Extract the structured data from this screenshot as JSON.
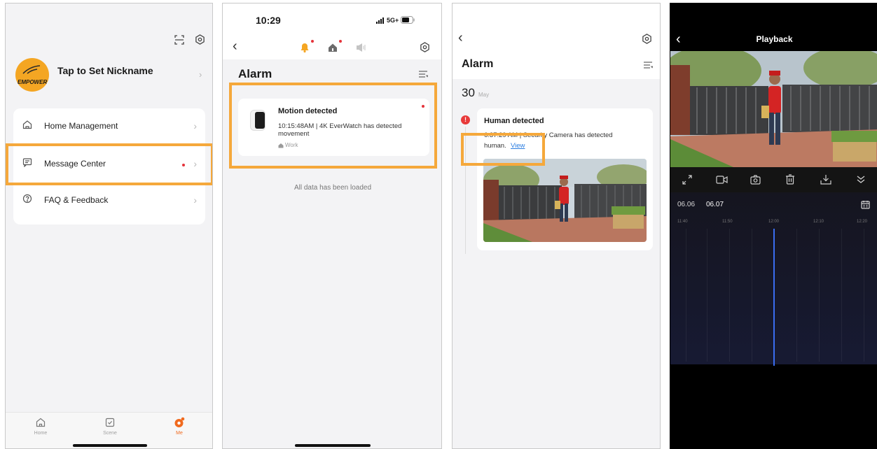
{
  "me_screen": {
    "avatar_text": "EMPOWER",
    "nickname": "Tap to Set Nickname",
    "menu": [
      {
        "label": "Home Management",
        "icon": "home-icon"
      },
      {
        "label": "Message Center",
        "icon": "message-icon"
      },
      {
        "label": "FAQ & Feedback",
        "icon": "help-icon"
      }
    ],
    "tabs": [
      {
        "label": "Home",
        "icon": "home-tab-icon"
      },
      {
        "label": "Scene",
        "icon": "scene-tab-icon"
      },
      {
        "label": "Me",
        "icon": "me-tab-icon"
      }
    ],
    "colors": {
      "accent": "#f06a1e",
      "highlight": "#f5a83b",
      "unread_dot": "#e5333b"
    }
  },
  "alarm_list_screen": {
    "time": "10:29",
    "signal": "5G+",
    "title": "Alarm",
    "notification": {
      "title": "Motion detected",
      "body": "10:15:48AM | 4K EverWatch has detected movement",
      "location": "Work"
    },
    "footer": "All data has been loaded"
  },
  "alarm_detail_screen": {
    "title": "Alarm",
    "day": "30",
    "month": "May",
    "event": {
      "title": "Human detected",
      "body": "6:37:29 AM | Security Camera has detected",
      "body2": "human.",
      "view_link": "View"
    }
  },
  "playback_screen": {
    "title": "Playback",
    "dates": [
      "06.06",
      "06.07"
    ],
    "timeline_ticks": [
      "11:40",
      "11:50",
      "12:00",
      "12:10",
      "12:20"
    ],
    "toolbar_icons": [
      "fullscreen-icon",
      "record-icon",
      "snapshot-icon",
      "delete-icon",
      "download-icon",
      "expand-icon"
    ]
  }
}
